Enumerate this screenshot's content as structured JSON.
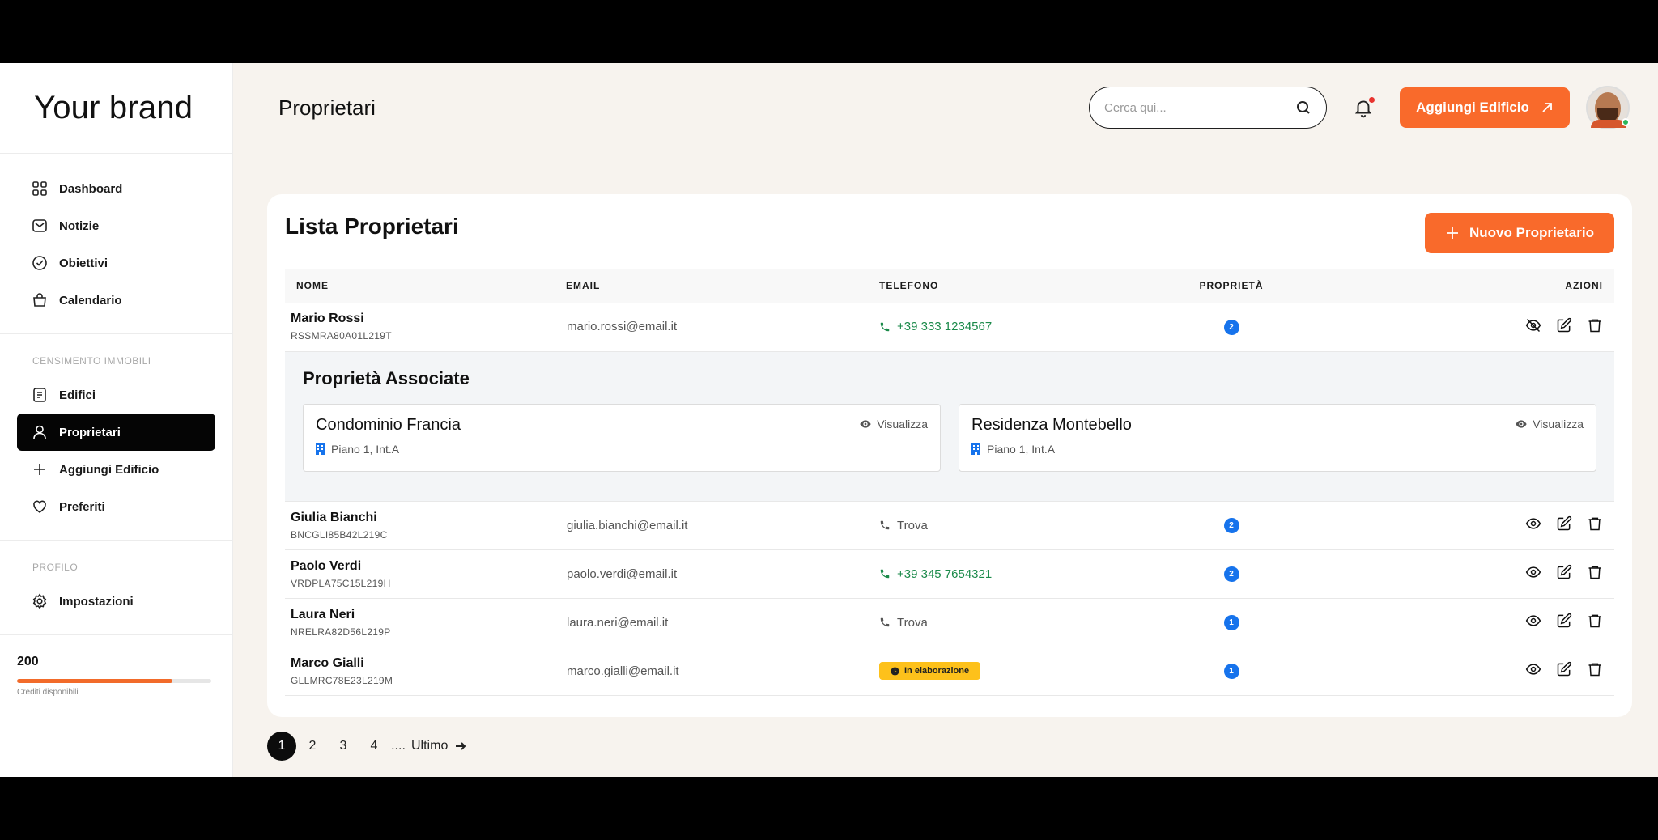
{
  "brand": "Your brand",
  "sidebar": {
    "main_items": [
      {
        "label": "Dashboard",
        "icon": "grid-icon"
      },
      {
        "label": "Notizie",
        "icon": "mail-icon"
      },
      {
        "label": "Obiettivi",
        "icon": "check-circle-icon"
      },
      {
        "label": "Calendario",
        "icon": "bag-icon"
      }
    ],
    "section_census": "CENSIMENTO IMMOBILI",
    "census_items": [
      {
        "label": "Edifici",
        "icon": "document-icon"
      },
      {
        "label": "Proprietari",
        "icon": "user-icon",
        "active": true
      },
      {
        "label": "Aggiungi Edificio",
        "icon": "plus-icon"
      },
      {
        "label": "Preferiti",
        "icon": "heart-icon"
      }
    ],
    "section_profile": "PROFILO",
    "profile_items": [
      {
        "label": "Impostazioni",
        "icon": "gear-icon"
      }
    ],
    "credits": {
      "value": "200",
      "label": "Crediti disponibili",
      "fill_fraction": 0.8
    }
  },
  "header": {
    "title": "Proprietari",
    "search_placeholder": "Cerca qui...",
    "add_building_label": "Aggiungi Edificio"
  },
  "card": {
    "title": "Lista Proprietari",
    "new_owner_label": "Nuovo Proprietario",
    "columns": [
      "NOME",
      "EMAIL",
      "TELEFONO",
      "PROPRIETÀ",
      "AZIONI"
    ],
    "rows": [
      {
        "name": "Mario Rossi",
        "cf": "RSSMRA80A01L219T",
        "email": "mario.rossi@email.it",
        "phone": "+39 333 1234567",
        "count": "2"
      },
      {
        "name": "Giulia Bianchi",
        "cf": "BNCGLI85B42L219C",
        "email": "giulia.bianchi@email.it",
        "phone": "Trova",
        "count": "2"
      },
      {
        "name": "Paolo Verdi",
        "cf": "VRDPLA75C15L219H",
        "email": "paolo.verdi@email.it",
        "phone": "+39 345 7654321",
        "count": "2"
      },
      {
        "name": "Laura Neri",
        "cf": "NRELRA82D56L219P",
        "email": "laura.neri@email.it",
        "phone": "Trova",
        "count": "1"
      },
      {
        "name": "Marco Gialli",
        "cf": "GLLMRC78E23L219M",
        "email": "marco.gialli@email.it",
        "phone": "In elaborazione",
        "count": "1"
      }
    ],
    "associated": {
      "title": "Proprietà Associate",
      "view_label": "Visualizza",
      "properties": [
        {
          "name": "Condominio Francia",
          "location": "Piano 1, Int.A"
        },
        {
          "name": "Residenza Montebello",
          "location": "Piano 1, Int.A"
        }
      ]
    }
  },
  "pagination": {
    "pages": [
      "1",
      "2",
      "3",
      "4"
    ],
    "dots": "....",
    "last": "Ultimo"
  },
  "colors": {
    "accent": "#f96a2b",
    "active_nav": "#050505",
    "phone_green": "#1b8a4a",
    "count_blue": "#1673ec",
    "status_yellow": "#fdc11b",
    "main_bg": "#f7f3ee"
  }
}
